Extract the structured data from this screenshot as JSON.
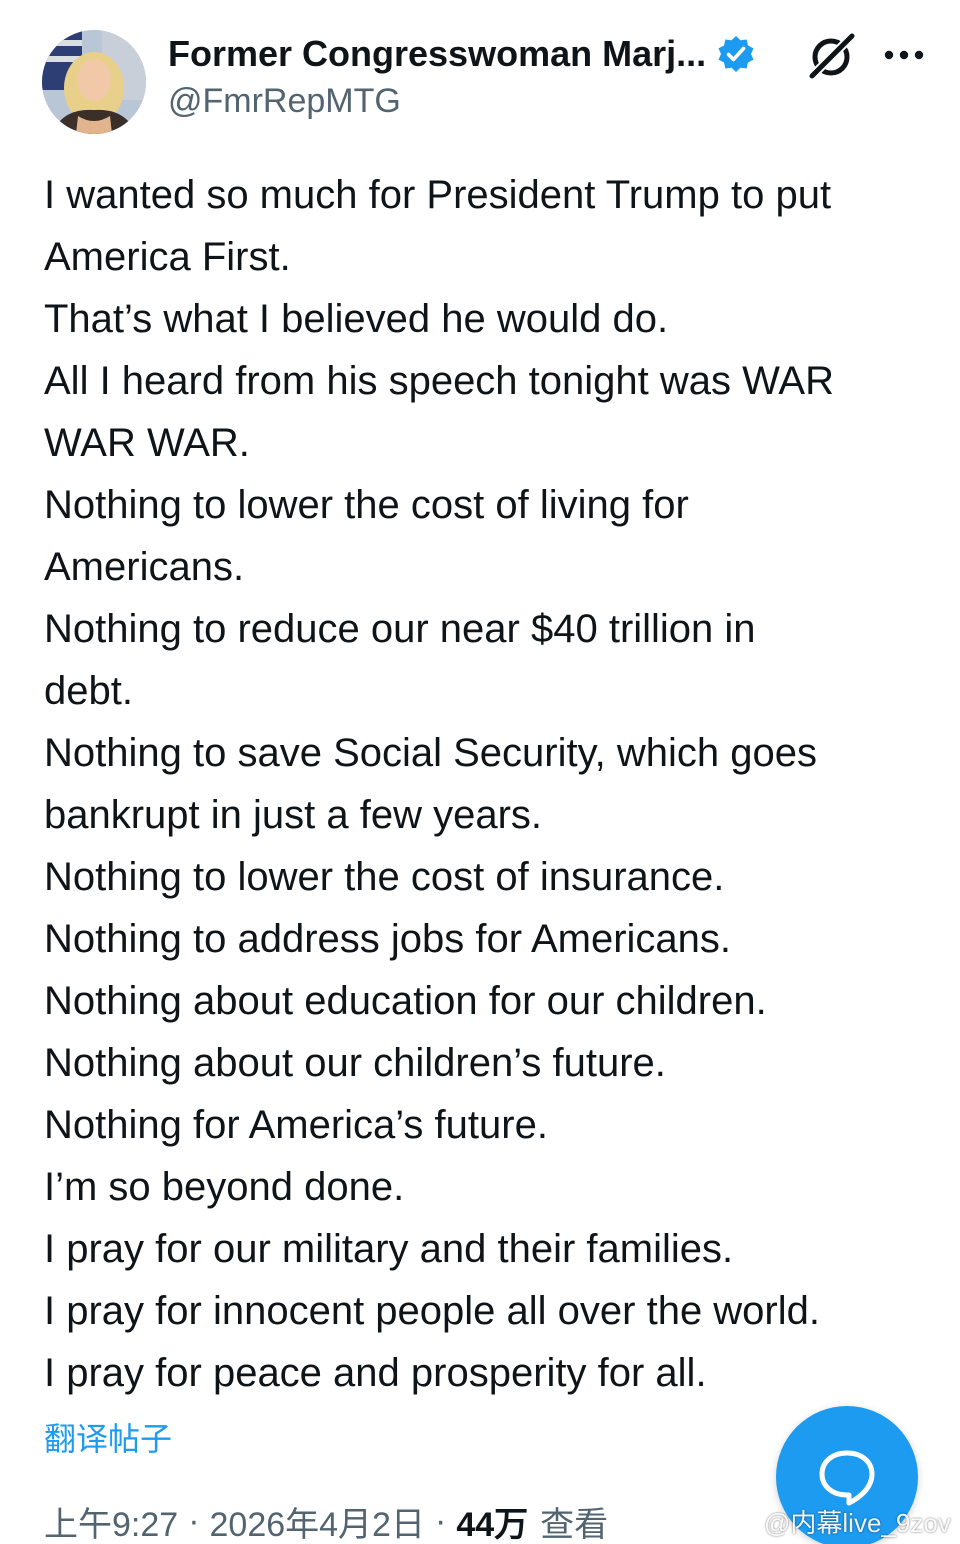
{
  "author": {
    "display_name": "Former Congresswoman Marj...",
    "handle": "@FmrRepMTG",
    "verified": true
  },
  "icons": {
    "verified": "verified-badge-icon",
    "grok": "grok-icon",
    "more": "more-options-icon",
    "compose": "compose-reply-icon",
    "watermark": "weibo-logo-icon"
  },
  "colors": {
    "accent": "#1d9bf0",
    "text_primary": "#0f1419",
    "text_secondary": "#536471"
  },
  "tweet": {
    "lines": [
      "I wanted so much for President Trump to put",
      "America First.",
      "That’s what I believed he would do.",
      "All I heard from his speech tonight was WAR",
      "WAR WAR.",
      "Nothing to lower the cost of living for",
      "Americans.",
      "Nothing to reduce our near $40 trillion in",
      "debt.",
      "Nothing to save Social Security, which goes",
      "bankrupt in just a few years.",
      "Nothing to lower the cost of insurance.",
      "Nothing to address jobs for Americans.",
      "Nothing about education for our children.",
      "Nothing about our children’s future.",
      "Nothing for America’s future.",
      "I’m so beyond done.",
      "I pray for our military and their families.",
      "I pray for innocent people all over the world.",
      "I pray for peace and prosperity for all."
    ],
    "translate_label": "翻译帖子"
  },
  "meta": {
    "time": "上午9:27",
    "date": "2026年4月2日",
    "separator": "·",
    "views_count": "44万",
    "views_label": "查看"
  },
  "watermark": {
    "text": "@内幕live_9zov"
  }
}
